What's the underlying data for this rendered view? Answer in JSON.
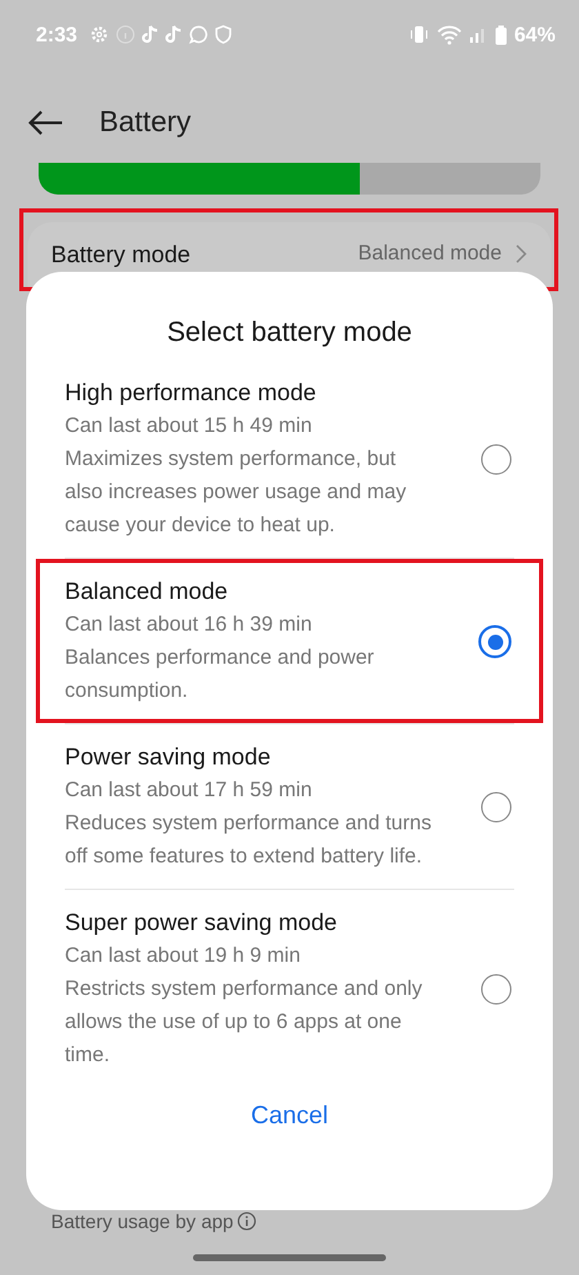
{
  "status_bar": {
    "time": "2:33",
    "battery": "64%"
  },
  "header": {
    "title": "Battery"
  },
  "battery_level": {
    "level": 0.64
  },
  "battery_mode_row": {
    "label": "Battery mode",
    "value": "Balanced mode",
    "highlighted": true
  },
  "sheet": {
    "title": "Select battery mode",
    "options": [
      {
        "title": "High performance mode",
        "estimate": "Can last about 15 h 49 min",
        "description": "Maximizes system performance, but also increases power usage and may cause your device to heat up.",
        "selected": false,
        "highlighted": false
      },
      {
        "title": "Balanced mode",
        "estimate": "Can last about 16 h 39 min",
        "description": "Balances performance and power consumption.",
        "selected": true,
        "highlighted": true
      },
      {
        "title": "Power saving mode",
        "estimate": "Can last about 17 h 59 min",
        "description": "Reduces system performance and turns off some features to extend battery life.",
        "selected": false,
        "highlighted": false
      },
      {
        "title": "Super power saving mode",
        "estimate": "Can last about 19 h 9 min",
        "description": "Restricts system performance and only allows the use of up to 6 apps at one time.",
        "selected": false,
        "highlighted": false
      }
    ],
    "cancel": "Cancel"
  },
  "footer": {
    "label": "Battery usage by app"
  }
}
